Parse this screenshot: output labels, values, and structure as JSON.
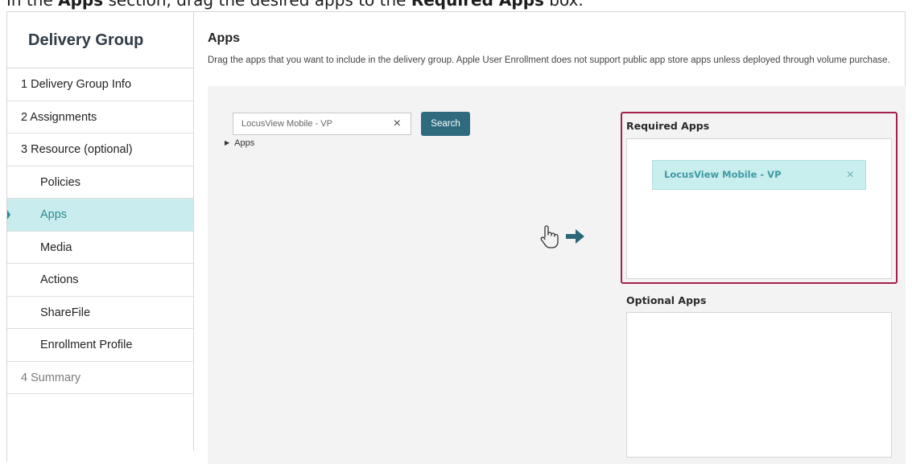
{
  "caption": {
    "prefix": "In the ",
    "section": "Apps",
    "middle": " section, drag the desired apps to the ",
    "target": "Required Apps",
    "suffix": " box."
  },
  "sidebar": {
    "title": "Delivery Group",
    "items": [
      {
        "label": "1 Delivery Group Info"
      },
      {
        "label": "2 Assignments"
      },
      {
        "label": "3 Resource (optional)"
      },
      {
        "label": "Policies"
      },
      {
        "label": "Apps"
      },
      {
        "label": "Media"
      },
      {
        "label": "Actions"
      },
      {
        "label": "ShareFile"
      },
      {
        "label": "Enrollment Profile"
      },
      {
        "label": "4 Summary"
      }
    ],
    "active_item": "Apps"
  },
  "main": {
    "title": "Apps",
    "description": "Drag the apps that you want to include in the delivery group. Apple User Enrollment does not support public app store apps unless deployed through volume purchase.",
    "search": {
      "value": "LocusView Mobile - VP",
      "clear_icon": "×",
      "button_label": "Search"
    },
    "apps_tree_label": "Apps",
    "drag_hint": {
      "icons": [
        "hand-pointer-icon",
        "arrow-right-icon"
      ]
    },
    "required_apps": {
      "label": "Required Apps",
      "items": [
        {
          "name": "LocusView Mobile - VP",
          "remove_icon": "×"
        }
      ]
    },
    "optional_apps": {
      "label": "Optional Apps",
      "items": []
    }
  },
  "colors": {
    "accent": "#2d8c92",
    "active_bg": "#c9ecee",
    "search_button": "#2f6b7e",
    "highlight_outline": "#a3214a",
    "panel_bg": "#f3f3f4"
  }
}
